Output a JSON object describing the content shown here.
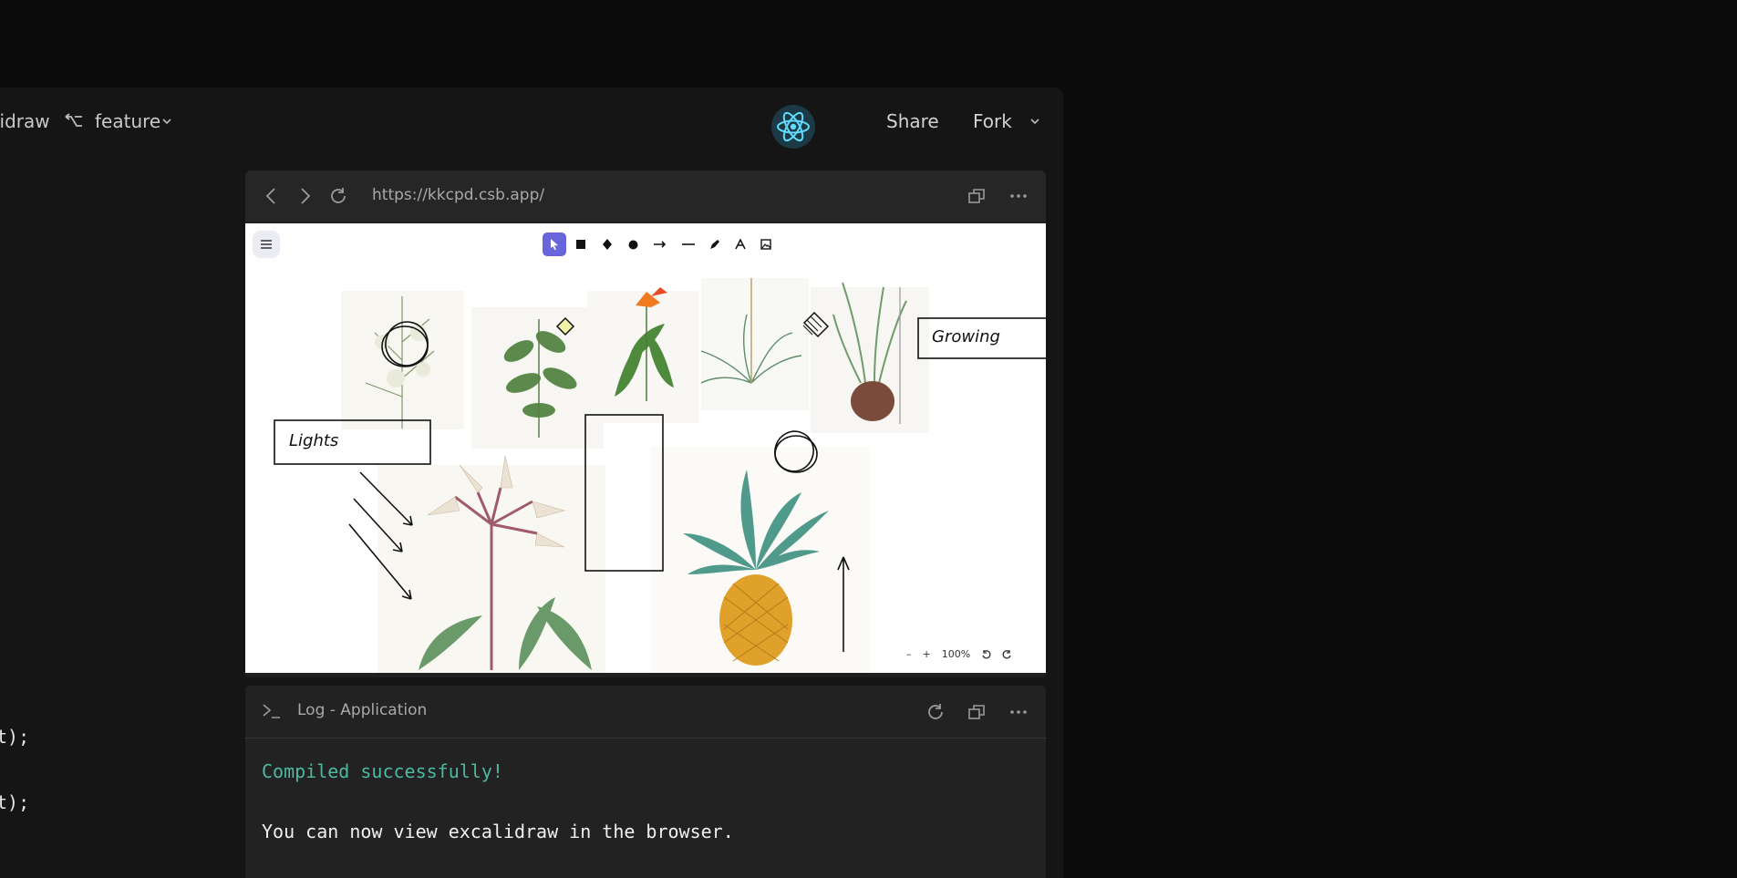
{
  "topbar": {
    "repo_name": "lidraw",
    "branch": "feature",
    "share_label": "Share",
    "fork_label": "Fork"
  },
  "code_lines": [
    "t);",
    "t);"
  ],
  "browser": {
    "url": "https://kkcpd.csb.app/"
  },
  "canvas": {
    "labels": {
      "lights": "Lights",
      "growing": "Growing"
    },
    "zoom": {
      "level": "100%",
      "minus": "–",
      "plus": "+"
    },
    "tools": [
      "selection",
      "rectangle",
      "diamond",
      "ellipse",
      "arrow",
      "line",
      "draw",
      "text",
      "image"
    ],
    "active_tool": "selection",
    "accent_color": "#6965db"
  },
  "log": {
    "title": "Log - Application",
    "lines": [
      {
        "text": "Compiled successfully!",
        "color": "#4eb8a1"
      },
      {
        "text": "You can now view excalidraw in the browser.",
        "color": "#f0f0f0"
      }
    ]
  }
}
